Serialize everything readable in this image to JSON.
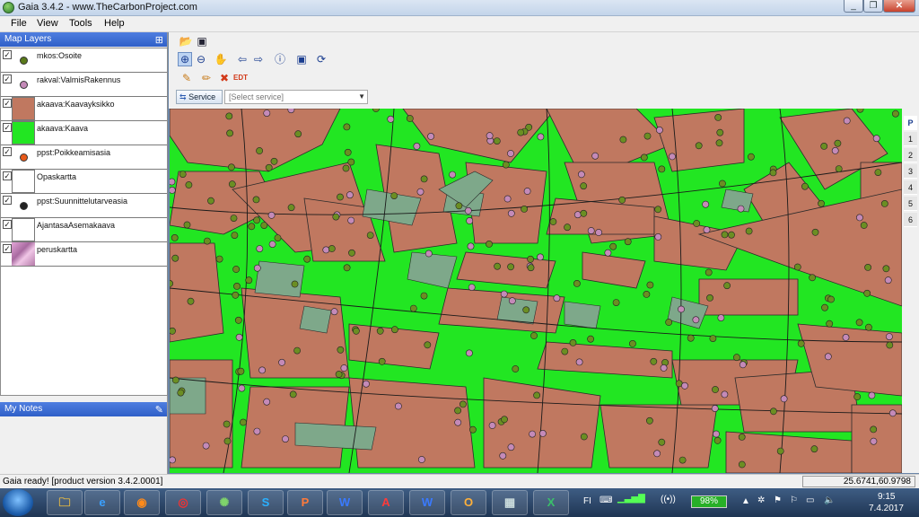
{
  "window": {
    "title": "Gaia 3.4.2 - www.TheCarbonProject.com"
  },
  "menu": [
    "File",
    "View",
    "Tools",
    "Help"
  ],
  "panels": {
    "map_layers": "Map Layers",
    "my_notes": "My Notes"
  },
  "layers": [
    {
      "name": "mkos:Osoite",
      "checked": true,
      "symbol": "dot",
      "color": "#5a7a1a"
    },
    {
      "name": "rakval:ValmisRakennus",
      "checked": true,
      "symbol": "dot",
      "color": "#c48ab8"
    },
    {
      "name": "akaava:Kaavayksikko",
      "checked": true,
      "symbol": "fill",
      "color": "#c07860"
    },
    {
      "name": "akaava:Kaava",
      "checked": true,
      "symbol": "fill",
      "color": "#22e622"
    },
    {
      "name": "ppst:Poikkeamisasia",
      "checked": true,
      "symbol": "dot",
      "color": "#e85a1a"
    },
    {
      "name": "Opaskartta",
      "checked": true,
      "symbol": "fill",
      "color": "#ffffff"
    },
    {
      "name": "ppst:Suunnittelutarveasia",
      "checked": true,
      "symbol": "dot",
      "color": "#222222"
    },
    {
      "name": "AjantasaAsemakaava",
      "checked": true,
      "symbol": "fill",
      "color": "#ffffff"
    },
    {
      "name": "peruskartta",
      "checked": true,
      "symbol": "image",
      "color": "#c58bc0"
    }
  ],
  "service": {
    "button_label": "Service",
    "select_placeholder": "[Select service]"
  },
  "pages": [
    "P",
    "1",
    "2",
    "3",
    "4",
    "5",
    "6"
  ],
  "status": {
    "message": "Gaia ready! [product version 3.4.2.0001]",
    "coordinates": "25.6741,60.9798"
  },
  "taskbar": {
    "tray_lang": "FI",
    "battery": "98%",
    "time": "9:15",
    "date": "7.4.2017"
  },
  "colors": {
    "map_green": "#22e622",
    "parcel_brown": "#c07860",
    "building_gray": "#7ea88a",
    "point_olive": "#6b8e23",
    "point_pink": "#c48ab8"
  }
}
